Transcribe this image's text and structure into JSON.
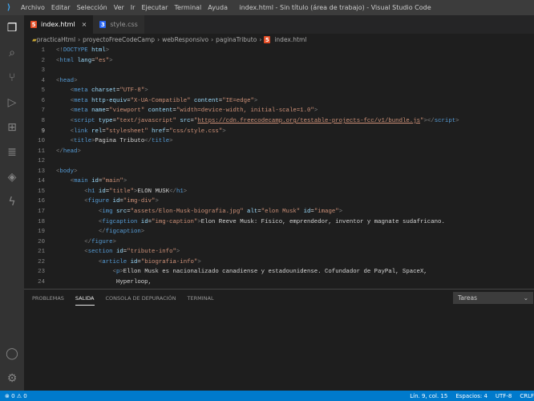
{
  "titlebar": {
    "menu": [
      "Archivo",
      "Editar",
      "Selección",
      "Ver",
      "Ir",
      "Ejecutar",
      "Terminal",
      "Ayuda"
    ],
    "title": "index.html - Sin título (área de trabajo) - Visual Studio Code"
  },
  "activity": [
    "files-icon",
    "search-icon",
    "source-control-icon",
    "run-debug-icon",
    "extensions-icon",
    "database-icon",
    "layers-icon",
    "lightning-icon"
  ],
  "activity_bottom": [
    "account-icon",
    "gear-icon"
  ],
  "tabs": [
    {
      "label": "index.html",
      "type": "html",
      "active": true
    },
    {
      "label": "style.css",
      "type": "css",
      "active": false
    }
  ],
  "breadcrumb": [
    "practicaHtml",
    "proyectoFreeCodeCamp",
    "webResponsivo",
    "paginaTributo",
    "index.html"
  ],
  "code": [
    [
      [
        "p",
        "<!"
      ],
      [
        "g",
        "DOCTYPE"
      ],
      [
        "a",
        " html"
      ],
      [
        "p",
        ">"
      ]
    ],
    [
      [
        "p",
        "<"
      ],
      [
        "g",
        "html"
      ],
      [
        "a",
        " lang"
      ],
      [
        "x",
        "="
      ],
      [
        "s",
        "\"es\""
      ],
      [
        "p",
        ">"
      ]
    ],
    [],
    [
      [
        "p",
        "<"
      ],
      [
        "g",
        "head"
      ],
      [
        "p",
        ">"
      ]
    ],
    [
      [
        "x",
        "    "
      ],
      [
        "p",
        "<"
      ],
      [
        "g",
        "meta"
      ],
      [
        "a",
        " charset"
      ],
      [
        "x",
        "="
      ],
      [
        "s",
        "\"UTF-8\""
      ],
      [
        "p",
        ">"
      ]
    ],
    [
      [
        "x",
        "    "
      ],
      [
        "p",
        "<"
      ],
      [
        "g",
        "meta"
      ],
      [
        "a",
        " http-equiv"
      ],
      [
        "x",
        "="
      ],
      [
        "s",
        "\"X-UA-Compatible\""
      ],
      [
        "a",
        " content"
      ],
      [
        "x",
        "="
      ],
      [
        "s",
        "\"IE=edge\""
      ],
      [
        "p",
        ">"
      ]
    ],
    [
      [
        "x",
        "    "
      ],
      [
        "p",
        "<"
      ],
      [
        "g",
        "meta"
      ],
      [
        "a",
        " name"
      ],
      [
        "x",
        "="
      ],
      [
        "s",
        "\"viewport\""
      ],
      [
        "a",
        " content"
      ],
      [
        "x",
        "="
      ],
      [
        "s",
        "\"width=device-width, initial-scale=1.0\""
      ],
      [
        "p",
        ">"
      ]
    ],
    [
      [
        "x",
        "    "
      ],
      [
        "p",
        "<"
      ],
      [
        "g",
        "script"
      ],
      [
        "a",
        " type"
      ],
      [
        "x",
        "="
      ],
      [
        "s",
        "\"text/javascript\""
      ],
      [
        "a",
        " src"
      ],
      [
        "x",
        "="
      ],
      [
        "s",
        "\""
      ],
      [
        "u",
        "https://cdn.freecodecamp.org/testable-projects-fcc/v1/bundle.js"
      ],
      [
        "s",
        "\""
      ],
      [
        "p",
        "></"
      ],
      [
        "g",
        "script"
      ],
      [
        "p",
        ">"
      ]
    ],
    [
      [
        "x",
        "    "
      ],
      [
        "p",
        "<"
      ],
      [
        "g",
        "link"
      ],
      [
        "a",
        " rel"
      ],
      [
        "x",
        "="
      ],
      [
        "s",
        "\"stylesheet\""
      ],
      [
        "a",
        " href"
      ],
      [
        "x",
        "="
      ],
      [
        "s",
        "\"css/style.css\""
      ],
      [
        "p",
        ">"
      ]
    ],
    [
      [
        "x",
        "    "
      ],
      [
        "p",
        "<"
      ],
      [
        "g",
        "title"
      ],
      [
        "p",
        ">"
      ],
      [
        "x",
        "Pagina Tributo"
      ],
      [
        "p",
        "</"
      ],
      [
        "g",
        "title"
      ],
      [
        "p",
        ">"
      ]
    ],
    [
      [
        "p",
        "</"
      ],
      [
        "g",
        "head"
      ],
      [
        "p",
        ">"
      ]
    ],
    [],
    [
      [
        "p",
        "<"
      ],
      [
        "g",
        "body"
      ],
      [
        "p",
        ">"
      ]
    ],
    [
      [
        "x",
        "    "
      ],
      [
        "p",
        "<"
      ],
      [
        "g",
        "main"
      ],
      [
        "a",
        " id"
      ],
      [
        "x",
        "="
      ],
      [
        "s",
        "\"main\""
      ],
      [
        "p",
        ">"
      ]
    ],
    [
      [
        "x",
        "        "
      ],
      [
        "p",
        "<"
      ],
      [
        "g",
        "h1"
      ],
      [
        "a",
        " id"
      ],
      [
        "x",
        "="
      ],
      [
        "s",
        "\"title\""
      ],
      [
        "p",
        ">"
      ],
      [
        "x",
        "ELON MUSK"
      ],
      [
        "p",
        "</"
      ],
      [
        "g",
        "h1"
      ],
      [
        "p",
        ">"
      ]
    ],
    [
      [
        "x",
        "        "
      ],
      [
        "p",
        "<"
      ],
      [
        "g",
        "figure"
      ],
      [
        "a",
        " id"
      ],
      [
        "x",
        "="
      ],
      [
        "s",
        "\"img-div\""
      ],
      [
        "p",
        ">"
      ]
    ],
    [
      [
        "x",
        "            "
      ],
      [
        "p",
        "<"
      ],
      [
        "g",
        "img"
      ],
      [
        "a",
        " src"
      ],
      [
        "x",
        "="
      ],
      [
        "s",
        "\"assets/Elon-Musk-biografia.jpg\""
      ],
      [
        "a",
        " alt"
      ],
      [
        "x",
        "="
      ],
      [
        "s",
        "\"elon Musk\""
      ],
      [
        "a",
        " id"
      ],
      [
        "x",
        "="
      ],
      [
        "s",
        "\"image\""
      ],
      [
        "p",
        ">"
      ]
    ],
    [
      [
        "x",
        "            "
      ],
      [
        "p",
        "<"
      ],
      [
        "g",
        "figcaption"
      ],
      [
        "a",
        " id"
      ],
      [
        "x",
        "="
      ],
      [
        "s",
        "\"img-caption\""
      ],
      [
        "p",
        ">"
      ],
      [
        "x",
        "Elon Reeve Musk: Físico, emprendedor, inventor y magnate sudafricano."
      ]
    ],
    [
      [
        "x",
        "            "
      ],
      [
        "p",
        "</"
      ],
      [
        "g",
        "figcaption"
      ],
      [
        "p",
        ">"
      ]
    ],
    [
      [
        "x",
        "        "
      ],
      [
        "p",
        "</"
      ],
      [
        "g",
        "figure"
      ],
      [
        "p",
        ">"
      ]
    ],
    [
      [
        "x",
        "        "
      ],
      [
        "p",
        "<"
      ],
      [
        "g",
        "section"
      ],
      [
        "a",
        " id"
      ],
      [
        "x",
        "="
      ],
      [
        "s",
        "\"tribute-info\""
      ],
      [
        "p",
        ">"
      ]
    ],
    [
      [
        "x",
        "            "
      ],
      [
        "p",
        "<"
      ],
      [
        "g",
        "article"
      ],
      [
        "a",
        " id"
      ],
      [
        "x",
        "="
      ],
      [
        "s",
        "\"biografia-info\""
      ],
      [
        "p",
        ">"
      ]
    ],
    [
      [
        "x",
        "                "
      ],
      [
        "p",
        "<"
      ],
      [
        "g",
        "p"
      ],
      [
        "p",
        ">"
      ],
      [
        "x",
        "Ellon Musk es nacionalizado canadiense y estadounidense. Cofundador de PayPal, SpaceX,"
      ]
    ],
    [
      [
        "x",
        "                 Hyperloop,"
      ]
    ]
  ],
  "current_line": 9,
  "panel": {
    "tabs": [
      "PROBLEMAS",
      "SALIDA",
      "CONSOLA DE DEPURACIÓN",
      "TERMINAL"
    ],
    "active": "SALIDA",
    "select": "Tareas"
  },
  "status": {
    "errors": "0",
    "warnings": "0",
    "position": "Lín. 9, col. 15",
    "spaces": "Espacios: 4",
    "encoding": "UTF-8",
    "eol": "CRLF"
  },
  "colors": {
    "statusbar": "#007acc",
    "tag": "#569cd6",
    "attr": "#9cdcfe",
    "string": "#ce9178"
  }
}
